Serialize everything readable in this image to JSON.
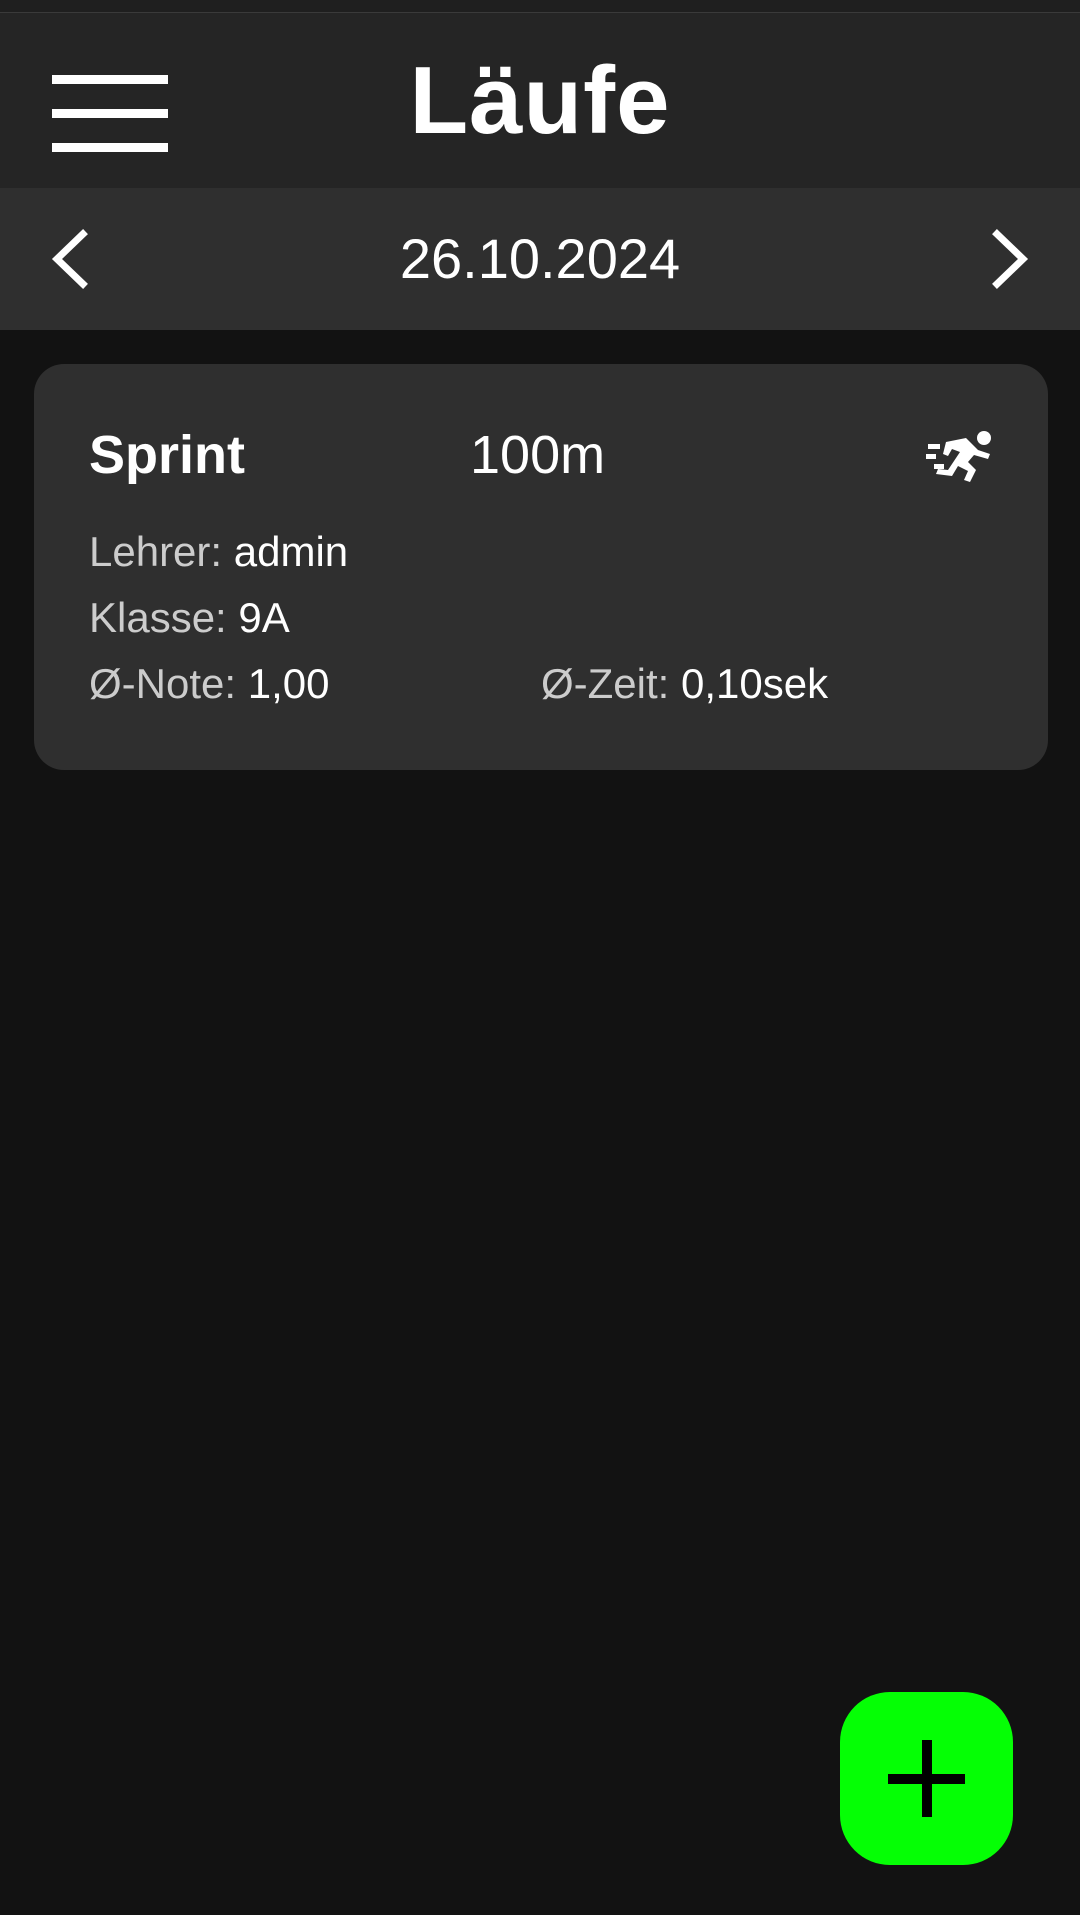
{
  "header": {
    "title": "Läufe",
    "menu_icon": "menu-icon"
  },
  "date_nav": {
    "date": "26.10.2024",
    "prev_icon": "chevron-left-icon",
    "next_icon": "chevron-right-icon"
  },
  "runs": [
    {
      "type": "Sprint",
      "distance": "100m",
      "icon": "running-person-icon",
      "teacher_label": "Lehrer:",
      "teacher": "admin",
      "class_label": "Klasse:",
      "class": "9A",
      "avg_grade_label": "Ø-Note:",
      "avg_grade": "1,00",
      "avg_time_label": "Ø-Zeit:",
      "avg_time": "0,10sek"
    }
  ],
  "fab": {
    "icon": "plus-icon"
  },
  "colors": {
    "background": "#121212",
    "app_bar": "#252525",
    "date_bar": "#2f2f2f",
    "card": "#2f2f2f",
    "fab": "#05ff05"
  }
}
